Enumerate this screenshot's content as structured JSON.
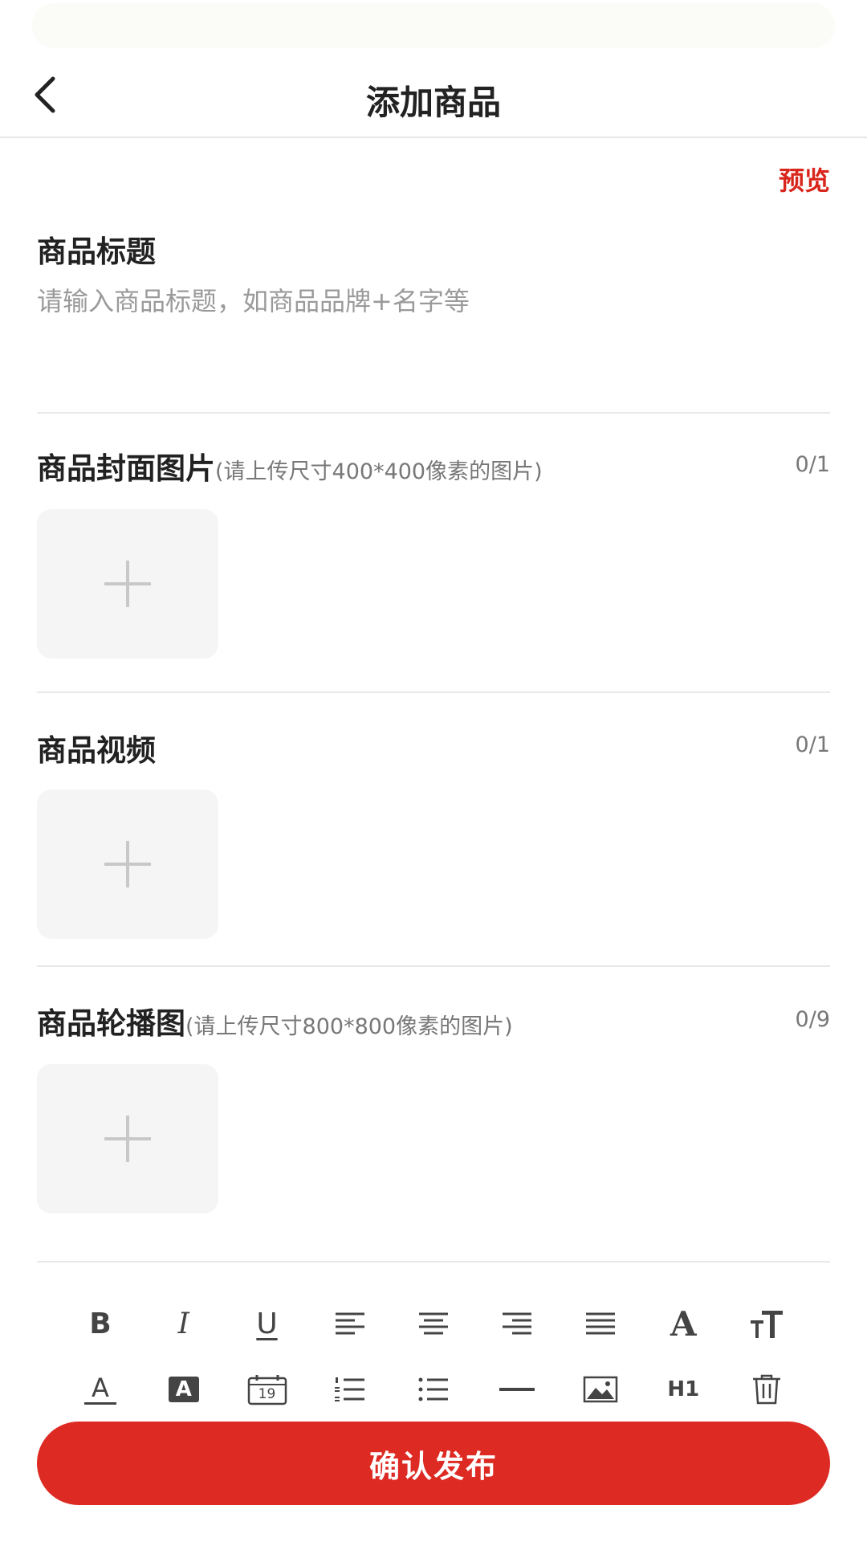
{
  "header": {
    "title": "添加商品",
    "preview_label": "预览"
  },
  "title_section": {
    "label": "商品标题",
    "placeholder": "请输入商品标题，如商品品牌+名字等",
    "value": ""
  },
  "cover_section": {
    "label": "商品封面图片",
    "hint": "(请上传尺寸400*400像素的图片)",
    "count": "0/1"
  },
  "video_section": {
    "label": "商品视频",
    "count": "0/1"
  },
  "carousel_section": {
    "label": "商品轮播图",
    "hint": "(请上传尺寸800*800像素的图片)",
    "count": "0/9"
  },
  "toolbar": {
    "row1": [
      "bold-icon",
      "italic-icon",
      "underline-icon",
      "align-left-icon",
      "align-center-icon",
      "align-right-icon",
      "align-justify-icon",
      "font-color-icon",
      "font-size-icon"
    ],
    "row2": [
      "text-color-icon",
      "highlight-icon",
      "date-icon",
      "ordered-list-icon",
      "bullet-list-icon",
      "horizontal-rule-icon",
      "image-icon",
      "heading-icon",
      "delete-icon"
    ],
    "bold": "B",
    "italic": "I",
    "underline": "U",
    "font": "A",
    "font_size": "TT",
    "text_color": "A",
    "highlight": "A",
    "date_day": "19",
    "heading": "H1"
  },
  "submit_label": "确认发布",
  "colors": {
    "accent": "#dd2a22",
    "preview": "#d9261c"
  }
}
